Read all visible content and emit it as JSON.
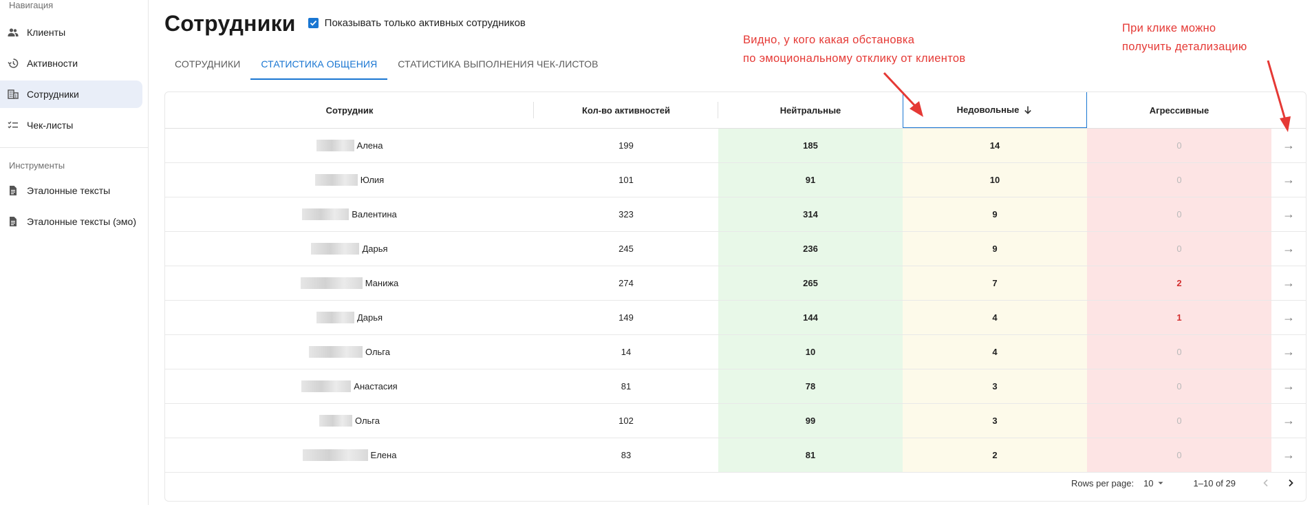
{
  "sidebar": {
    "nav_section": "Навигация",
    "nav_items": [
      {
        "label": "Клиенты",
        "icon": "people-icon"
      },
      {
        "label": "Активности",
        "icon": "history-icon"
      },
      {
        "label": "Сотрудники",
        "icon": "building-icon"
      },
      {
        "label": "Чек-листы",
        "icon": "checklist-icon"
      }
    ],
    "tools_section": "Инструменты",
    "tools_items": [
      {
        "label": "Эталонные тексты",
        "icon": "document-icon"
      },
      {
        "label": "Эталонные тексты (эмо)",
        "icon": "document-icon"
      }
    ]
  },
  "header": {
    "title": "Сотрудники",
    "active_only_label": "Показывать только активных сотрудников",
    "active_only_checked": true
  },
  "tabs": [
    {
      "label": "СОТРУДНИКИ"
    },
    {
      "label": "СТАТИСТИКА ОБЩЕНИЯ"
    },
    {
      "label": "СТАТИСТИКА ВЫПОЛНЕНИЯ ЧЕК-ЛИСТОВ"
    }
  ],
  "table": {
    "columns": [
      "Сотрудник",
      "Кол-во активностей",
      "Нейтральные",
      "Недовольные",
      "Агрессивные"
    ],
    "sorted_column": "Недовольные",
    "rows": [
      {
        "name": "Алена",
        "count": "199",
        "neutral": "185",
        "unhappy": "14",
        "aggressive": "0"
      },
      {
        "name": "Юлия",
        "count": "101",
        "neutral": "91",
        "unhappy": "10",
        "aggressive": "0"
      },
      {
        "name": "Валентина",
        "count": "323",
        "neutral": "314",
        "unhappy": "9",
        "aggressive": "0"
      },
      {
        "name": "Дарья",
        "count": "245",
        "neutral": "236",
        "unhappy": "9",
        "aggressive": "0"
      },
      {
        "name": "Манижа",
        "count": "274",
        "neutral": "265",
        "unhappy": "7",
        "aggressive": "2"
      },
      {
        "name": "Дарья",
        "count": "149",
        "neutral": "144",
        "unhappy": "4",
        "aggressive": "1"
      },
      {
        "name": "Ольга",
        "count": "14",
        "neutral": "10",
        "unhappy": "4",
        "aggressive": "0"
      },
      {
        "name": "Анастасия",
        "count": "81",
        "neutral": "78",
        "unhappy": "3",
        "aggressive": "0"
      },
      {
        "name": "Ольга",
        "count": "102",
        "neutral": "99",
        "unhappy": "3",
        "aggressive": "0"
      },
      {
        "name": "Елена",
        "count": "83",
        "neutral": "81",
        "unhappy": "2",
        "aggressive": "0"
      }
    ],
    "row_action": "→"
  },
  "pagination": {
    "rows_per_page_label": "Rows per page:",
    "rows_per_page": "10",
    "range": "1–10 of 29"
  },
  "annotations": {
    "emotion_note_line1": "Видно, у кого какая обстановка",
    "emotion_note_line2": "по эмоциональному отклику от клиентов",
    "click_note_line1": "При клике можно",
    "click_note_line2": "получить детализацию"
  },
  "colors": {
    "accent": "#1976d2",
    "neutral_bg": "#e8f8e8",
    "unhappy_bg": "#fdfaea",
    "aggressive_bg": "#fde4e4",
    "annotation": "#e53935"
  }
}
